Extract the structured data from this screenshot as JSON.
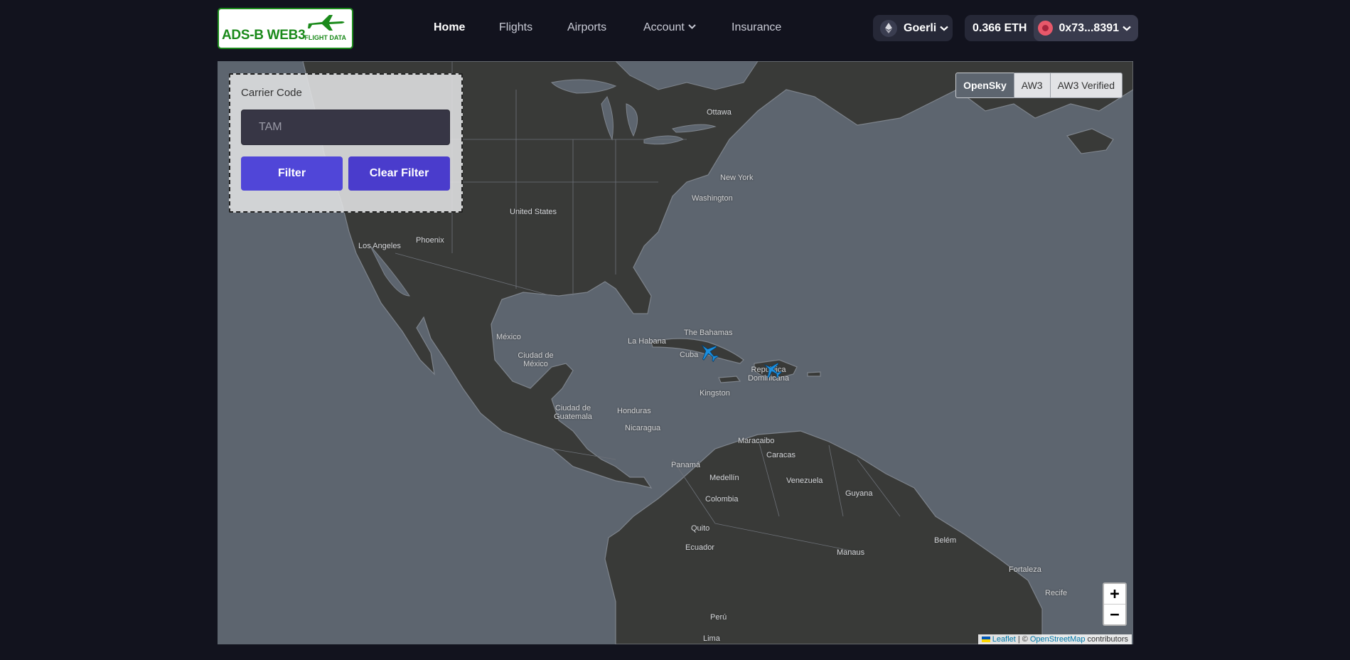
{
  "logo": {
    "title": "ADS-B WEB3",
    "subtitle": "FLIGHT DATA"
  },
  "nav": {
    "items": [
      {
        "label": "Home",
        "active": true
      },
      {
        "label": "Flights"
      },
      {
        "label": "Airports"
      },
      {
        "label": "Account",
        "dropdown": true
      },
      {
        "label": "Insurance"
      }
    ]
  },
  "wallet": {
    "network": "Goerli",
    "balance": "0.366 ETH",
    "address": "0x73...8391"
  },
  "filter": {
    "label": "Carrier Code",
    "placeholder": "TAM",
    "value": "",
    "filter_button": "Filter",
    "clear_button": "Clear Filter"
  },
  "layers": {
    "options": [
      "OpenSky",
      "AW3",
      "AW3 Verified"
    ],
    "selected": "OpenSky"
  },
  "map": {
    "labels": {
      "ottawa": "Ottawa",
      "new_york": "New York",
      "washington": "Washington",
      "united_states": "United States",
      "phoenix": "Phoenix",
      "los_angeles": "Los Angeles",
      "mexico": "México",
      "ciudad_de_mexico": "Ciudad de México",
      "la_habana": "La Habana",
      "bahamas": "The Bahamas",
      "cuba": "Cuba",
      "republica_dominicana": "República Dominicana",
      "kingston": "Kingston",
      "ciudad_de_guatemala": "Ciudad de Guatemala",
      "honduras": "Honduras",
      "nicaragua": "Nicaragua",
      "panama": "Panamá",
      "maracaibo": "Maracaibo",
      "caracas": "Caracas",
      "venezuela": "Venezuela",
      "medellin": "Medellín",
      "colombia": "Colombia",
      "guyana": "Guyana",
      "quito": "Quito",
      "ecuador": "Ecuador",
      "manaus": "Manaus",
      "belem": "Belém",
      "fortaleza": "Fortaleza",
      "recife": "Recife",
      "peru": "Perú",
      "lima": "Lima"
    },
    "aircraft_count": 2,
    "zoom_in": "+",
    "zoom_out": "−"
  },
  "attribution": {
    "leaflet": "Leaflet",
    "separator": "| ©",
    "osm": "OpenStreetMap",
    "suffix": "contributors"
  },
  "colors": {
    "background": "#12131e",
    "ocean": "#5d656f",
    "land": "#393a38",
    "accent": "#5046d8",
    "logo_green": "#1b8a1b",
    "plane": "#1a8fe0"
  }
}
